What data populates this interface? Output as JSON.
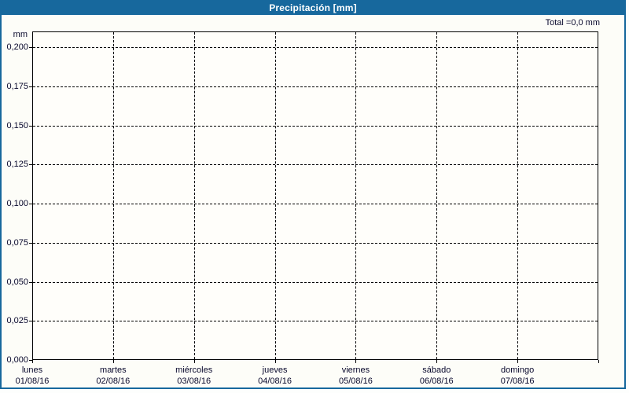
{
  "window": {
    "title": "Precipitación [mm]"
  },
  "colors": {
    "accent_blue": "#17689d",
    "grid_line": "#000000",
    "label_text": "#08082c",
    "title_text": "#ffffff"
  },
  "summary": {
    "total_label": "Total =0,0 mm"
  },
  "y_axis": {
    "unit": "mm",
    "tick_labels": [
      "0,200",
      "0,175",
      "0,150",
      "0,125",
      "0,100",
      "0,075",
      "0,050",
      "0,025",
      "0,000"
    ]
  },
  "x_axis": {
    "days": [
      {
        "day": "lunes",
        "date": "01/08/16"
      },
      {
        "day": "martes",
        "date": "02/08/16"
      },
      {
        "day": "miércoles",
        "date": "03/08/16"
      },
      {
        "day": "jueves",
        "date": "04/08/16"
      },
      {
        "day": "viernes",
        "date": "05/08/16"
      },
      {
        "day": "sábado",
        "date": "06/08/16"
      },
      {
        "day": "domingo",
        "date": "07/08/16"
      }
    ]
  },
  "chart_data": {
    "type": "bar",
    "title": "Precipitación [mm]",
    "ylabel": "mm",
    "xlabel": "",
    "categories": [
      "01/08/16",
      "02/08/16",
      "03/08/16",
      "04/08/16",
      "05/08/16",
      "06/08/16",
      "07/08/16"
    ],
    "category_days": [
      "lunes",
      "martes",
      "miércoles",
      "jueves",
      "viernes",
      "sábado",
      "domingo"
    ],
    "values": [
      0,
      0,
      0,
      0,
      0,
      0,
      0
    ],
    "ylim": [
      0,
      0.21
    ],
    "y_tick_step": 0.025,
    "y_tick_values": [
      0.2,
      0.175,
      0.15,
      0.125,
      0.1,
      0.075,
      0.05,
      0.025,
      0.0
    ],
    "grid": "dashed, horizontal and vertical",
    "legend_position": "none",
    "total_annotation": "Total =0,0 mm"
  }
}
